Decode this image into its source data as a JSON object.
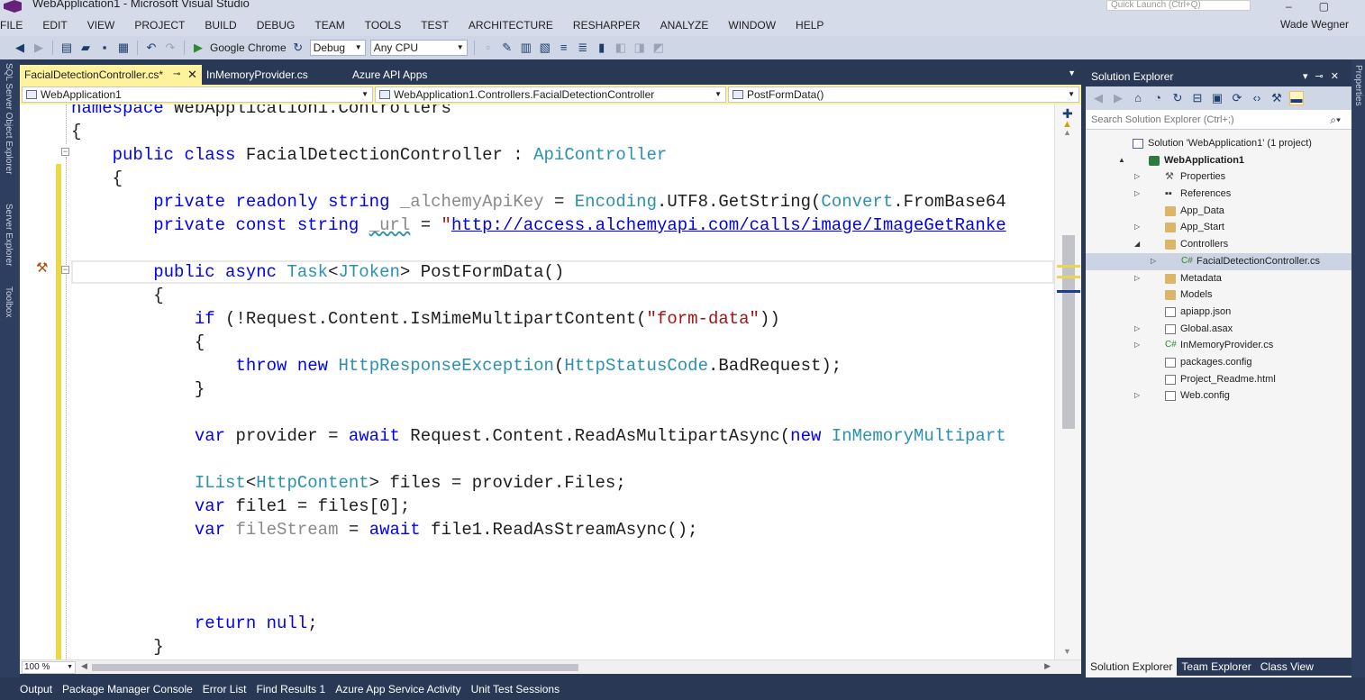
{
  "window": {
    "title": "WebApplication1 - Microsoft Visual Studio",
    "quick_launch_placeholder": "Quick Launch (Ctrl+Q)",
    "user": "Wade Wegner"
  },
  "menu": [
    "FILE",
    "EDIT",
    "VIEW",
    "PROJECT",
    "BUILD",
    "DEBUG",
    "TEAM",
    "TOOLS",
    "TEST",
    "ARCHITECTURE",
    "RESHARPER",
    "ANALYZE",
    "WINDOW",
    "HELP"
  ],
  "toolbar": {
    "run_target": "Google Chrome",
    "configuration": "Debug",
    "platform": "Any CPU"
  },
  "left_tool_tabs": [
    "SQL Server Object Explorer",
    "Server Explorer",
    "Toolbox"
  ],
  "right_tool_tabs": [
    "Properties"
  ],
  "doc_tabs": [
    {
      "label": "FacialDetectionController.cs*",
      "active": true
    },
    {
      "label": "InMemoryProvider.cs",
      "active": false
    },
    {
      "label": "Azure API Apps",
      "active": false
    }
  ],
  "nav": {
    "project": "WebApplication1",
    "type": "WebApplication1.Controllers.FacialDetectionController",
    "member": "PostFormData()"
  },
  "code_lines": [
    "namespace WebApplication1.Controllers",
    "{",
    "    public class FacialDetectionController : ApiController",
    "    {",
    "        private readonly string _alchemyApiKey = Encoding.UTF8.GetString(Convert.FromBase64",
    "        private const string _url = \"http://access.alchemyapi.com/calls/image/ImageGetRanke",
    "",
    "        public async Task<JToken> PostFormData()",
    "        {",
    "            if (!Request.Content.IsMimeMultipartContent(\"form-data\"))",
    "            {",
    "                throw new HttpResponseException(HttpStatusCode.BadRequest);",
    "            }",
    "",
    "            var provider = await Request.Content.ReadAsMultipartAsync(new InMemoryMultipart",
    "",
    "            IList<HttpContent> files = provider.Files;",
    "            var file1 = files[0];",
    "            var fileStream = await file1.ReadAsStreamAsync();",
    "",
    "",
    "",
    "            return null;",
    "        }"
  ],
  "editor": {
    "zoom": "100 %"
  },
  "solution_explorer": {
    "title": "Solution Explorer",
    "search_placeholder": "Search Solution Explorer (Ctrl+;)",
    "tree": [
      {
        "label": "Solution 'WebApplication1' (1 project)",
        "icon": "solution-icon",
        "level": 0,
        "exp": ""
      },
      {
        "label": "WebApplication1",
        "icon": "project-icon",
        "level": 1,
        "exp": "▲",
        "bold": true
      },
      {
        "label": "Properties",
        "icon": "wrench-icon",
        "level": 2,
        "exp": "▷"
      },
      {
        "label": "References",
        "icon": "references-icon",
        "level": 2,
        "exp": "▷"
      },
      {
        "label": "App_Data",
        "icon": "folder-icon",
        "level": 2,
        "exp": ""
      },
      {
        "label": "App_Start",
        "icon": "folder-icon",
        "level": 2,
        "exp": "▷"
      },
      {
        "label": "Controllers",
        "icon": "folder-icon",
        "level": 2,
        "exp": "◢"
      },
      {
        "label": "FacialDetectionController.cs",
        "icon": "csharp-file-icon",
        "level": 3,
        "exp": "▷",
        "selected": true
      },
      {
        "label": "Metadata",
        "icon": "folder-icon",
        "level": 2,
        "exp": "▷"
      },
      {
        "label": "Models",
        "icon": "folder-icon",
        "level": 2,
        "exp": ""
      },
      {
        "label": "apiapp.json",
        "icon": "file-icon",
        "level": 2,
        "exp": ""
      },
      {
        "label": "Global.asax",
        "icon": "file-icon",
        "level": 2,
        "exp": "▷"
      },
      {
        "label": "InMemoryProvider.cs",
        "icon": "csharp-file-icon",
        "level": 2,
        "exp": "▷"
      },
      {
        "label": "packages.config",
        "icon": "file-icon",
        "level": 2,
        "exp": ""
      },
      {
        "label": "Project_Readme.html",
        "icon": "file-icon",
        "level": 2,
        "exp": ""
      },
      {
        "label": "Web.config",
        "icon": "file-icon",
        "level": 2,
        "exp": "▷"
      }
    ],
    "bottom_tabs": [
      {
        "label": "Solution Explorer",
        "active": true
      },
      {
        "label": "Team Explorer",
        "active": false
      },
      {
        "label": "Class View",
        "active": false
      }
    ]
  },
  "bottom_tabs": [
    "Output",
    "Package Manager Console",
    "Error List",
    "Find Results 1",
    "Azure App Service Activity",
    "Unit Test Sessions"
  ]
}
